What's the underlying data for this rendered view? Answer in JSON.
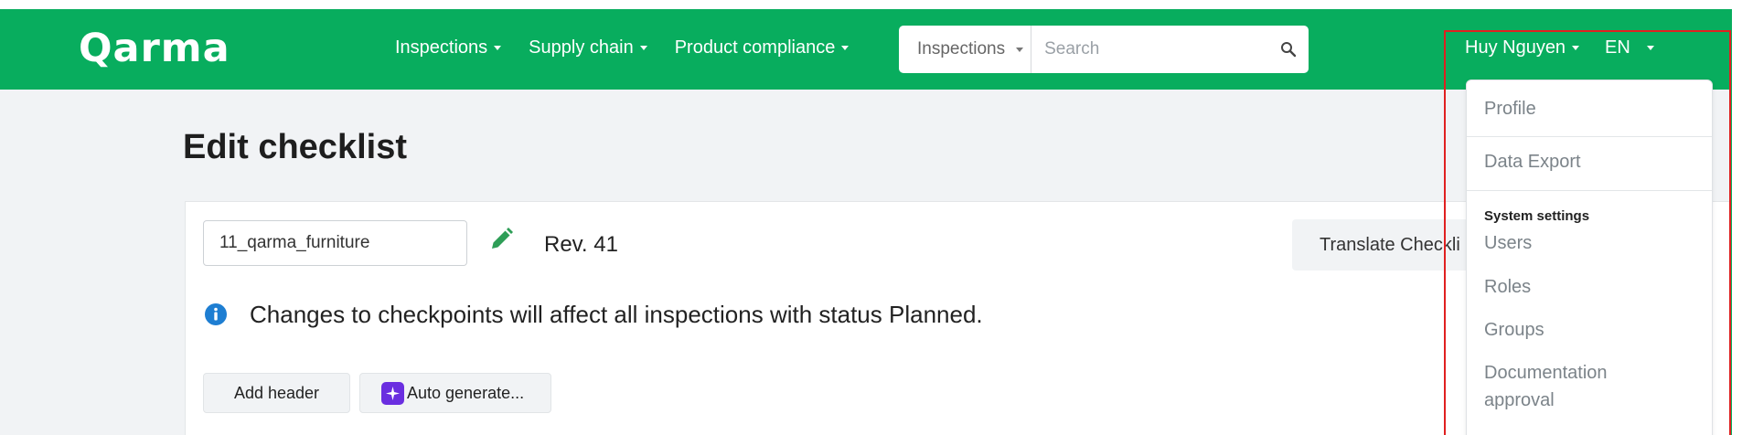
{
  "header": {
    "logo": "Qarma",
    "nav": [
      {
        "label": "Inspections"
      },
      {
        "label": "Supply chain"
      },
      {
        "label": "Product compliance"
      }
    ],
    "search": {
      "scope": "Inspections",
      "placeholder": "Search"
    },
    "user_name": "Huy Nguyen",
    "language": "EN"
  },
  "main": {
    "title": "Edit checklist",
    "checklist_name": "11_qarma_furniture",
    "revision": "Rev. 41",
    "translate_button": "Translate Checkli",
    "info_message": "Changes to checkpoints will affect all inspections with status Planned.",
    "add_header_button": "Add header",
    "auto_generate_button": "Auto generate..."
  },
  "user_dropdown": {
    "items": [
      "Profile",
      "Data Export"
    ],
    "system_settings_heading": "System settings",
    "system_items": [
      "Users",
      "Roles",
      "Groups",
      "Documentation approval"
    ]
  },
  "colors": {
    "brand_green": "#08ad5e",
    "info_blue": "#1e7ed2",
    "ai_purple": "#6a2ee0",
    "highlight_red": "#e02020"
  }
}
